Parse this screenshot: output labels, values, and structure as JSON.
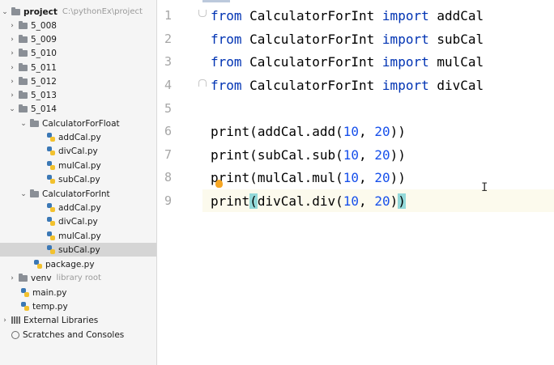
{
  "project": {
    "name": "project",
    "path": "C:\\pythonEx\\project",
    "folders": [
      {
        "label": "5_008"
      },
      {
        "label": "5_009"
      },
      {
        "label": "5_010"
      },
      {
        "label": "5_011"
      },
      {
        "label": "5_012"
      },
      {
        "label": "5_013"
      },
      {
        "label": "5_014"
      }
    ],
    "float_pkg": {
      "label": "CalculatorForFloat",
      "files": [
        "addCal.py",
        "divCal.py",
        "mulCal.py",
        "subCal.py"
      ]
    },
    "int_pkg": {
      "label": "CalculatorForInt",
      "files": [
        "addCal.py",
        "divCal.py",
        "mulCal.py",
        "subCal.py"
      ]
    },
    "package_file": "package.py",
    "venv": {
      "label": "venv",
      "note": "library root"
    },
    "root_files": [
      "main.py",
      "temp.py"
    ],
    "external_libraries": "External Libraries",
    "scratches": "Scratches and Consoles"
  },
  "editor": {
    "line_numbers": [
      "1",
      "2",
      "3",
      "4",
      "5",
      "6",
      "7",
      "8",
      "9"
    ],
    "imports": [
      {
        "kw1": "from",
        "module": " CalculatorForInt ",
        "kw2": "import",
        "name": " addCal"
      },
      {
        "kw1": "from",
        "module": " CalculatorForInt ",
        "kw2": "import",
        "name": " subCal"
      },
      {
        "kw1": "from",
        "module": " CalculatorForInt ",
        "kw2": "import",
        "name": " mulCal"
      },
      {
        "kw1": "from",
        "module": " CalculatorForInt ",
        "kw2": "import",
        "name": " divCal"
      }
    ],
    "calls": [
      {
        "fn": "print",
        "open": "(",
        "body": "addCal.add(",
        "a": "10",
        "sep": ", ",
        "b": "20",
        "close": "))"
      },
      {
        "fn": "print",
        "open": "(",
        "body": "subCal.sub(",
        "a": "10",
        "sep": ", ",
        "b": "20",
        "close": "))"
      },
      {
        "fn": "print",
        "open": "(",
        "body": "mulCal.mul(",
        "a": "10",
        "sep": ", ",
        "b": "20",
        "close": "))"
      },
      {
        "fn": "print",
        "open": "(",
        "body": "divCal.div(",
        "a": "10",
        "sep": ", ",
        "b": "20",
        "close_inner": ")",
        "close": ")"
      }
    ]
  },
  "colors": {
    "keyword": "#0033b3",
    "number": "#1750eb",
    "selection": "#d5d5d5",
    "brace_match": "#93d9d9"
  }
}
